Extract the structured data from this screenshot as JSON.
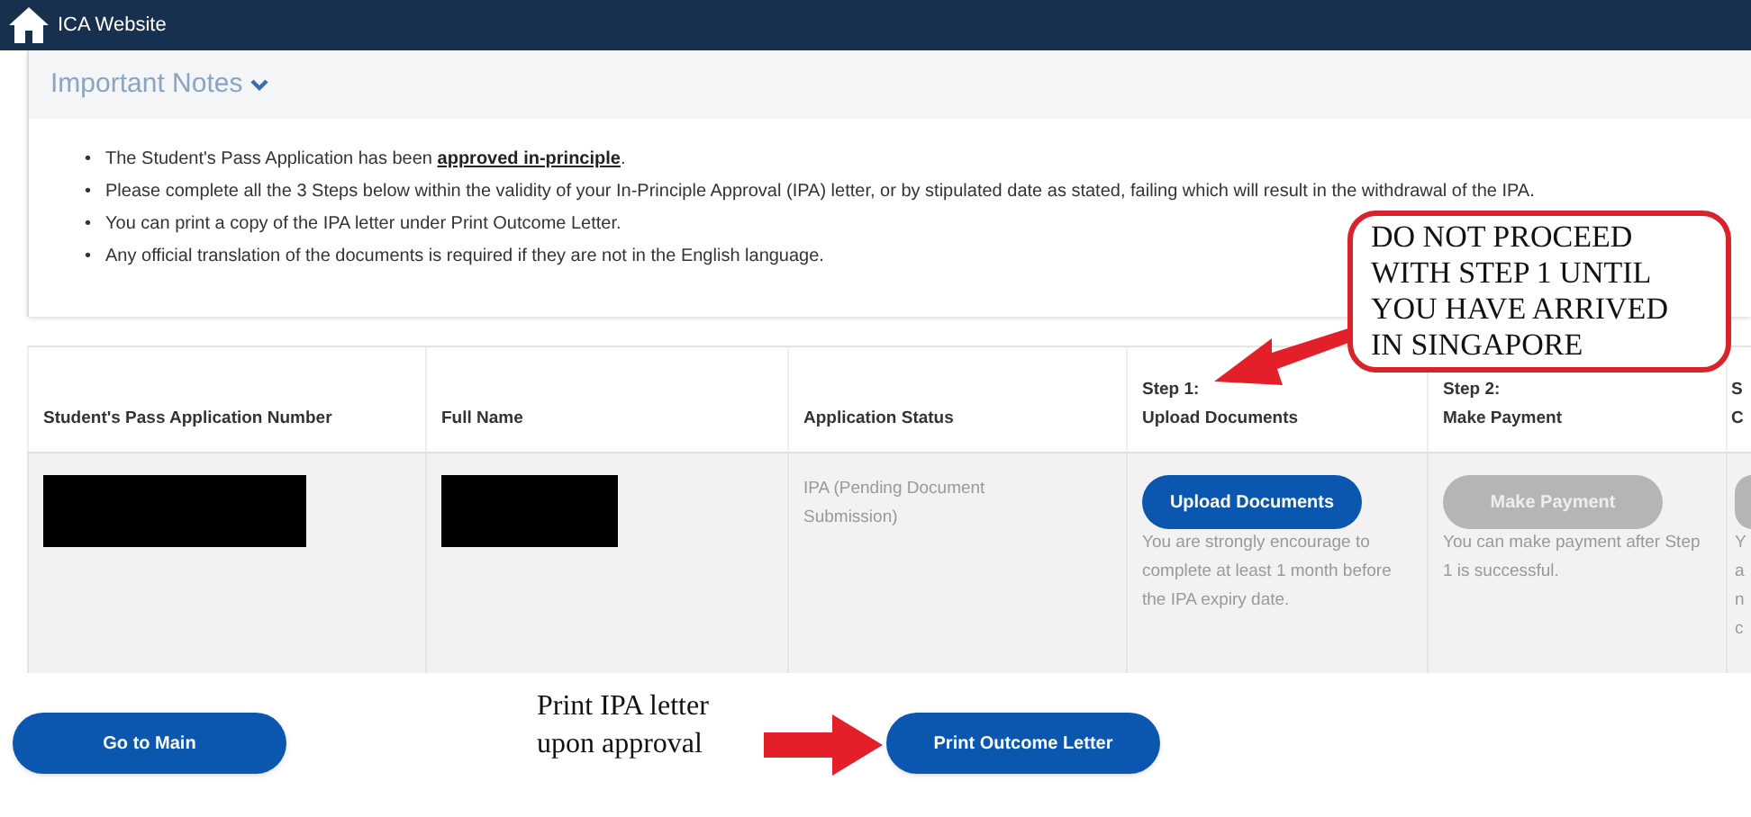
{
  "header": {
    "title": "ICA Website"
  },
  "notes": {
    "title": "Important Notes",
    "expanded": true,
    "bullet": "•",
    "items": [
      "The Student's Pass Application has been **approved in-principle**.",
      "Please complete all the 3 Steps below within the validity of your In-Principle Approval (IPA) letter, or by stipulated date as stated, failing which will result in the withdrawal of the IPA.",
      "You can print a copy of the IPA letter under Print Outcome Letter.",
      "Any official translation of the documents is required if they are not in the English language."
    ]
  },
  "table": {
    "columns": [
      {
        "lines": [
          "Student's Pass Application Number"
        ]
      },
      {
        "lines": [
          "Full Name"
        ]
      },
      {
        "lines": [
          "Application Status"
        ]
      },
      {
        "lines": [
          "Step 1:",
          "Upload Documents"
        ]
      },
      {
        "lines": [
          "Step 2:",
          "Make Payment"
        ]
      },
      {
        "lines": [
          "S",
          "C"
        ]
      }
    ],
    "rows": [
      {
        "cells": [
          {
            "kind": "redacted"
          },
          {
            "kind": "redacted"
          },
          {
            "kind": "text",
            "text": "IPA (Pending Document Submission)"
          },
          {
            "kind": "action",
            "button": "Upload Documents",
            "disabled": false,
            "note": "You are strongly encourage to complete at least 1 month before the IPA expiry date."
          },
          {
            "kind": "action",
            "button": "Make Payment",
            "disabled": true,
            "note": "You can make payment after Step 1 is successful."
          },
          {
            "kind": "cut",
            "disabled": true,
            "lines": [
              "Y",
              "a",
              "n",
              "c"
            ]
          }
        ]
      }
    ]
  },
  "buttons": [
    {
      "label": "Go to Main"
    },
    {
      "label": "Print Outcome Letter"
    }
  ],
  "annotations": [
    {
      "kind": "callout",
      "text": "DO NOT PROCEED WITH STEP 1 UNTIL YOU HAVE ARRIVED IN SINGAPORE"
    },
    {
      "kind": "label",
      "text": "Print IPA letter upon approval"
    }
  ]
}
